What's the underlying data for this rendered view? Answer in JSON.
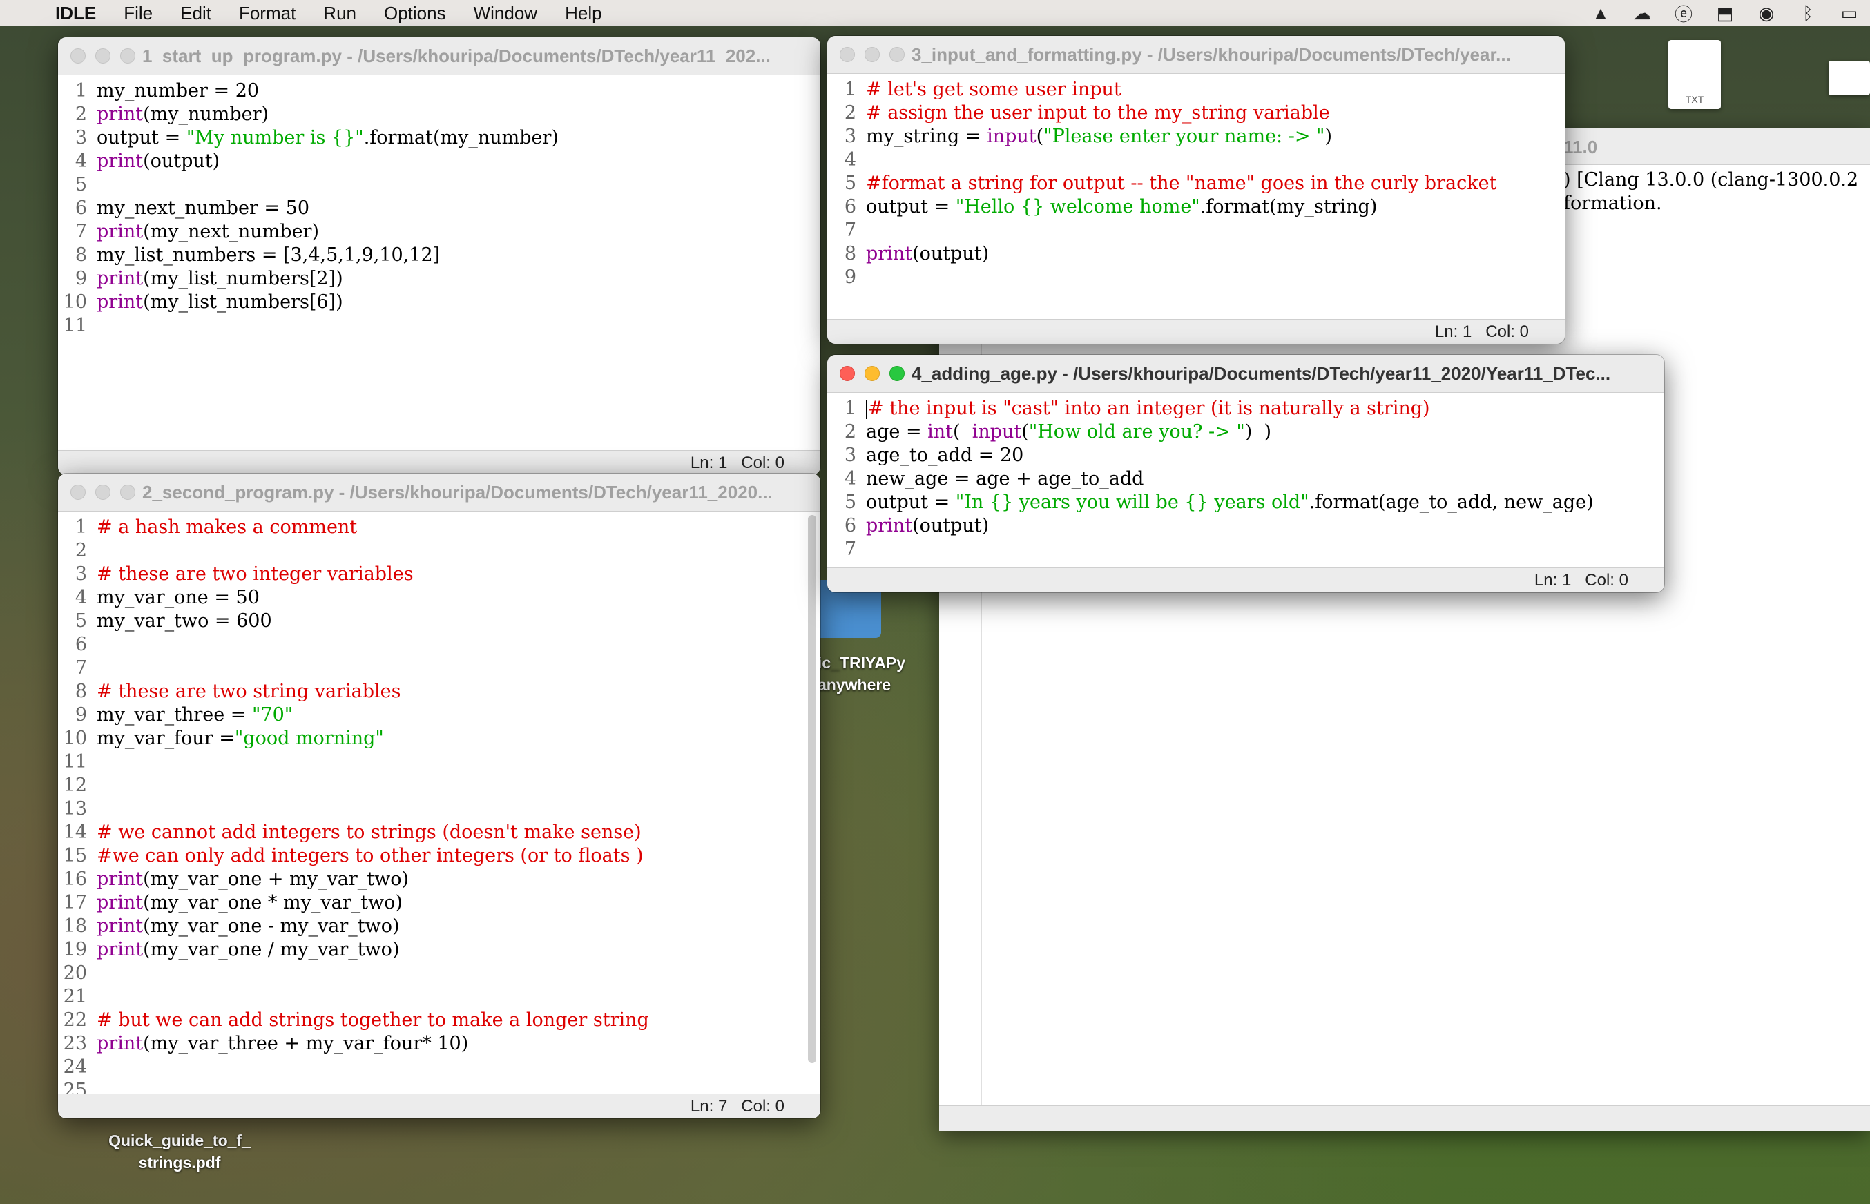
{
  "menubar": {
    "app": "IDLE",
    "items": [
      "File",
      "Edit",
      "Format",
      "Run",
      "Options",
      "Window",
      "Help"
    ]
  },
  "desktop": {
    "file_icon_label": "TXT",
    "label1_line1": "ic_TRIYAPy",
    "label1_line2": "anywhere",
    "label2_line1": "Quick_guide_to_f_",
    "label2_line2": "strings.pdf"
  },
  "shell": {
    "title_fragment": "11.0",
    "line1": ") [Clang 13.0.0 (clang-1300.0.2",
    "line2": "formation."
  },
  "windows": {
    "w1": {
      "title": "1_start_up_program.py - /Users/khouripa/Documents/DTech/year11_202...",
      "status_ln": "Ln: 1",
      "status_col": "Col: 0",
      "lines": [
        [
          [
            "my_number = 20",
            "code"
          ]
        ],
        [
          [
            "print",
            "c-builtin"
          ],
          [
            "(my_number)",
            "code"
          ]
        ],
        [
          [
            "output = ",
            "code"
          ],
          [
            "\"My number is {}\"",
            "c-string"
          ],
          [
            ".format(my_number)",
            "code"
          ]
        ],
        [
          [
            "print",
            "c-builtin"
          ],
          [
            "(output)",
            "code"
          ]
        ],
        [],
        [
          [
            "my_next_number = 50",
            "code"
          ]
        ],
        [
          [
            "print",
            "c-builtin"
          ],
          [
            "(my_next_number)",
            "code"
          ]
        ],
        [
          [
            "my_list_numbers = [3,4,5,1,9,10,12]",
            "code"
          ]
        ],
        [
          [
            "print",
            "c-builtin"
          ],
          [
            "(my_list_numbers[2])",
            "code"
          ]
        ],
        [
          [
            "print",
            "c-builtin"
          ],
          [
            "(my_list_numbers[6])",
            "code"
          ]
        ],
        []
      ]
    },
    "w2": {
      "title": "2_second_program.py - /Users/khouripa/Documents/DTech/year11_2020...",
      "status_ln": "Ln: 7",
      "status_col": "Col: 0",
      "lines": [
        [
          [
            "# a hash makes a comment",
            "c-comment"
          ]
        ],
        [],
        [
          [
            "# these are two integer variables",
            "c-comment"
          ]
        ],
        [
          [
            "my_var_one = 50",
            "code"
          ]
        ],
        [
          [
            "my_var_two = 600",
            "code"
          ]
        ],
        [],
        [],
        [
          [
            "# these are two string variables",
            "c-comment"
          ]
        ],
        [
          [
            "my_var_three = ",
            "code"
          ],
          [
            "\"70\"",
            "c-string"
          ]
        ],
        [
          [
            "my_var_four =",
            "code"
          ],
          [
            "\"good morning\"",
            "c-string"
          ]
        ],
        [],
        [],
        [],
        [
          [
            "# we cannot add integers to strings (doesn't make sense)",
            "c-comment"
          ]
        ],
        [
          [
            "#we can only add integers to other integers (or to floats )",
            "c-comment"
          ]
        ],
        [
          [
            "print",
            "c-builtin"
          ],
          [
            "(my_var_one + my_var_two)",
            "code"
          ]
        ],
        [
          [
            "print",
            "c-builtin"
          ],
          [
            "(my_var_one * my_var_two)",
            "code"
          ]
        ],
        [
          [
            "print",
            "c-builtin"
          ],
          [
            "(my_var_one - my_var_two)",
            "code"
          ]
        ],
        [
          [
            "print",
            "c-builtin"
          ],
          [
            "(my_var_one / my_var_two)",
            "code"
          ]
        ],
        [],
        [],
        [
          [
            "# but we can add strings together to make a longer string",
            "c-comment"
          ]
        ],
        [
          [
            "print",
            "c-builtin"
          ],
          [
            "(my_var_three + my_var_four* 10)",
            "code"
          ]
        ],
        [],
        []
      ]
    },
    "w3": {
      "title": "3_input_and_formatting.py - /Users/khouripa/Documents/DTech/year...",
      "status_ln": "Ln: 1",
      "status_col": "Col: 0",
      "lines": [
        [
          [
            "# let's get some user input",
            "c-comment"
          ]
        ],
        [
          [
            "# assign the user input to the my_string variable",
            "c-comment"
          ]
        ],
        [
          [
            "my_string = ",
            "code"
          ],
          [
            "input",
            "c-builtin"
          ],
          [
            "(",
            "code"
          ],
          [
            "\"Please enter your name: -> \"",
            "c-string"
          ],
          [
            ")",
            "code"
          ]
        ],
        [],
        [
          [
            "#format a string for output -- the \"name\" goes in the curly bracket",
            "c-comment"
          ]
        ],
        [
          [
            "output = ",
            "code"
          ],
          [
            "\"Hello {} welcome home\"",
            "c-string"
          ],
          [
            ".format(my_string)",
            "code"
          ]
        ],
        [],
        [
          [
            "print",
            "c-builtin"
          ],
          [
            "(output)",
            "code"
          ]
        ],
        []
      ]
    },
    "w4": {
      "title": "4_adding_age.py - /Users/khouripa/Documents/DTech/year11_2020/Year11_DTec...",
      "status_ln": "Ln: 1",
      "status_col": "Col: 0",
      "lines": [
        [
          [
            "# the input is \"cast\" into an integer (it is naturally a string)",
            "c-comment"
          ]
        ],
        [
          [
            "age = ",
            "code"
          ],
          [
            "int",
            "c-builtin"
          ],
          [
            "(  ",
            "code"
          ],
          [
            "input",
            "c-builtin"
          ],
          [
            "(",
            "code"
          ],
          [
            "\"How old are you? -> \"",
            "c-string"
          ],
          [
            ")  )",
            "code"
          ]
        ],
        [
          [
            "age_to_add = 20",
            "code"
          ]
        ],
        [
          [
            "new_age = age + age_to_add",
            "code"
          ]
        ],
        [
          [
            "output = ",
            "code"
          ],
          [
            "\"In {} years you will be {} years old\"",
            "c-string"
          ],
          [
            ".format(age_to_add, new_age)",
            "code"
          ]
        ],
        [
          [
            "print",
            "c-builtin"
          ],
          [
            "(output)",
            "code"
          ]
        ],
        []
      ]
    }
  }
}
